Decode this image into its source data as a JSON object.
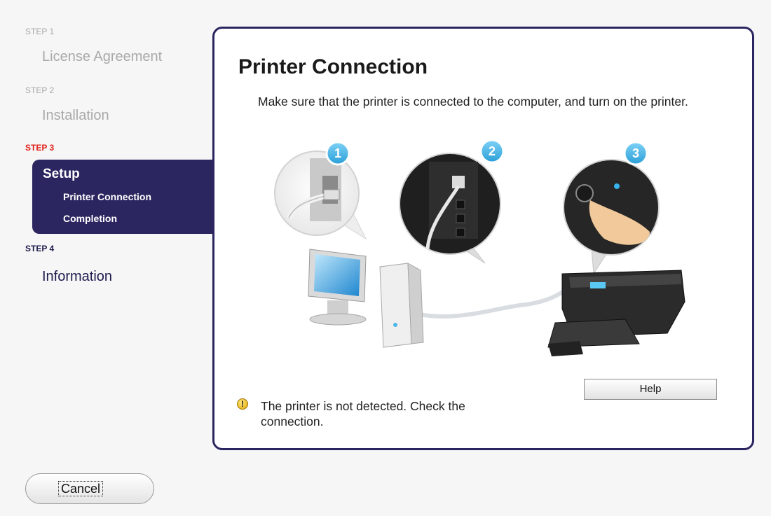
{
  "sidebar": {
    "step1": {
      "label": "STEP 1",
      "title": "License Agreement"
    },
    "step2": {
      "label": "STEP 2",
      "title": "Installation"
    },
    "step3": {
      "label": "STEP 3",
      "title": "Setup",
      "items": [
        "Printer Connection",
        "Completion"
      ]
    },
    "step4": {
      "label": "STEP 4",
      "title": "Information"
    }
  },
  "main": {
    "title": "Printer Connection",
    "description": "Make sure that the printer is connected to the computer, and turn on the printer.",
    "steps": [
      "1",
      "2",
      "3"
    ],
    "help_label": "Help",
    "warning": {
      "icon": "warning-icon",
      "text": "The printer is not detected. Check the connection."
    }
  },
  "footer": {
    "cancel_label": "Cancel"
  },
  "colors": {
    "accent_dark": "#2c2660",
    "active_step": "#e0201a",
    "badge": "#3ab3e8"
  }
}
